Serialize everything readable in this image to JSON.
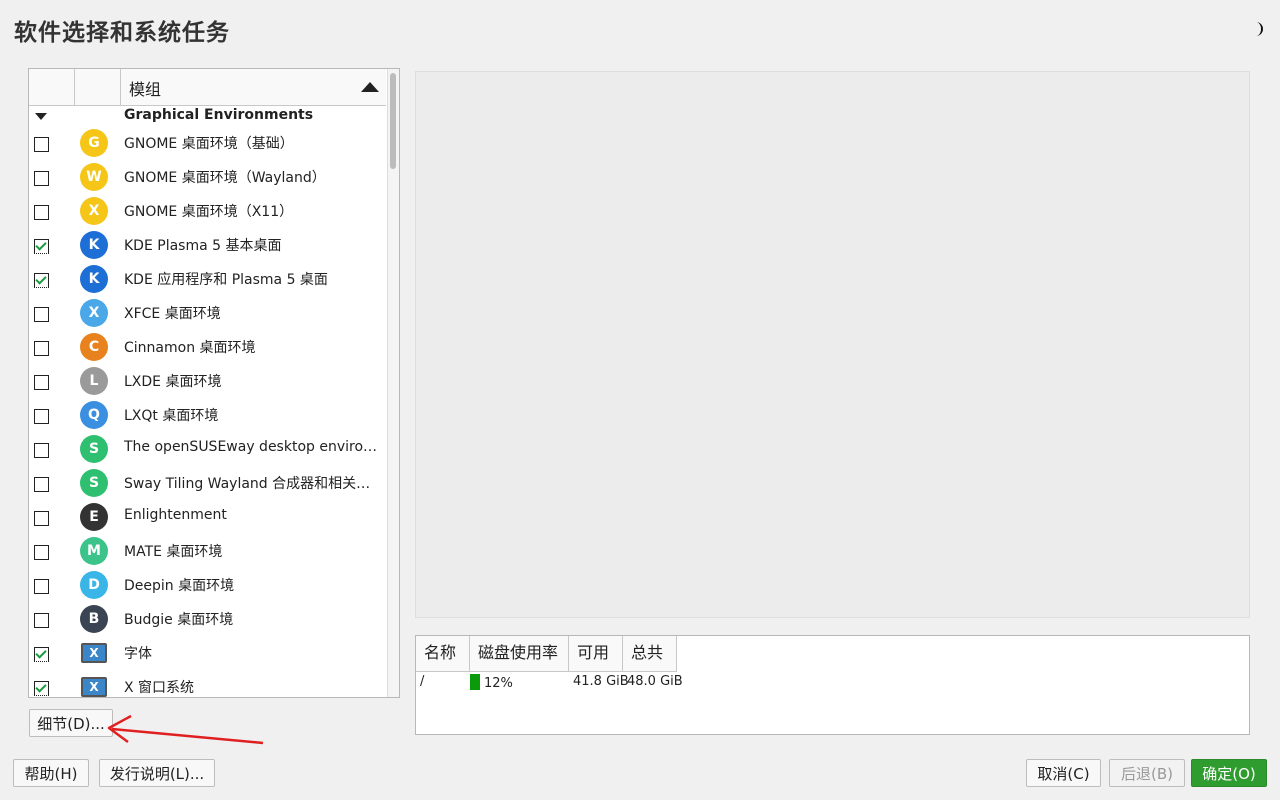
{
  "window": {
    "title": "软件选择和系统任务"
  },
  "header_toggle_icon": "moon-icon",
  "list": {
    "column_header": "模组",
    "group": "Graphical Environments",
    "items": [
      {
        "label": "GNOME 桌面环境（基础）",
        "checked": false,
        "icon": "gnome-icon",
        "glyph": "G",
        "color": "#f5c518"
      },
      {
        "label": "GNOME 桌面环境（Wayland）",
        "checked": false,
        "icon": "gnome-wayland-icon",
        "glyph": "W",
        "color": "#f5c518"
      },
      {
        "label": "GNOME 桌面环境（X11）",
        "checked": false,
        "icon": "gnome-x11-icon",
        "glyph": "X",
        "color": "#f5c518"
      },
      {
        "label": "KDE Plasma 5 基本桌面",
        "checked": true,
        "icon": "kde-icon",
        "glyph": "K",
        "color": "#1d6fd6"
      },
      {
        "label": "KDE 应用程序和 Plasma 5 桌面",
        "checked": true,
        "icon": "kde-icon",
        "glyph": "K",
        "color": "#1d6fd6"
      },
      {
        "label": "XFCE 桌面环境",
        "checked": false,
        "icon": "xfce-icon",
        "glyph": "X",
        "color": "#4aa8e8"
      },
      {
        "label": "Cinnamon 桌面环境",
        "checked": false,
        "icon": "cinnamon-icon",
        "glyph": "C",
        "color": "#e8821e"
      },
      {
        "label": "LXDE 桌面环境",
        "checked": false,
        "icon": "lxde-icon",
        "glyph": "L",
        "color": "#9a9a9a"
      },
      {
        "label": "LXQt 桌面环境",
        "checked": false,
        "icon": "lxqt-icon",
        "glyph": "Q",
        "color": "#3b8fe0"
      },
      {
        "label": "The openSUSEway desktop environment …",
        "checked": false,
        "icon": "opensuseway-icon",
        "glyph": "S",
        "color": "#2fbf71"
      },
      {
        "label": "Sway Tiling Wayland 合成器和相关工具",
        "checked": false,
        "icon": "sway-icon",
        "glyph": "S",
        "color": "#2fbf71"
      },
      {
        "label": "Enlightenment",
        "checked": false,
        "icon": "enlightenment-icon",
        "glyph": "E",
        "color": "#333333"
      },
      {
        "label": "MATE 桌面环境",
        "checked": false,
        "icon": "mate-icon",
        "glyph": "M",
        "color": "#3cc38a"
      },
      {
        "label": "Deepin 桌面环境",
        "checked": false,
        "icon": "deepin-icon",
        "glyph": "D",
        "color": "#39b5e8"
      },
      {
        "label": "Budgie 桌面环境",
        "checked": false,
        "icon": "budgie-icon",
        "glyph": "B",
        "color": "#3b4452"
      },
      {
        "label": "字体",
        "checked": true,
        "icon": "x-window-icon",
        "glyph": "X",
        "color": "#3a86c8"
      },
      {
        "label": "X 窗口系统",
        "checked": true,
        "icon": "x-window-icon",
        "glyph": "X",
        "color": "#3a86c8"
      }
    ]
  },
  "details_button": "细节(D)...",
  "disk": {
    "headers": [
      "名称",
      "磁盘使用率",
      "可用",
      "总共"
    ],
    "rows": [
      {
        "name": "/",
        "usage": "12%",
        "usage_fraction": 0.12,
        "available": "41.8 GiB",
        "total": "48.0 GiB"
      }
    ]
  },
  "buttons": {
    "help": "帮助(H)",
    "release_notes": "发行说明(L)...",
    "cancel": "取消(C)",
    "back": "后退(B)",
    "ok": "确定(O)"
  },
  "colors": {
    "ok_button": "#2f9c2f",
    "usage_bar": "#0a9a0a",
    "check": "#1a9c3c",
    "annotation_arrow": "#e02020"
  }
}
